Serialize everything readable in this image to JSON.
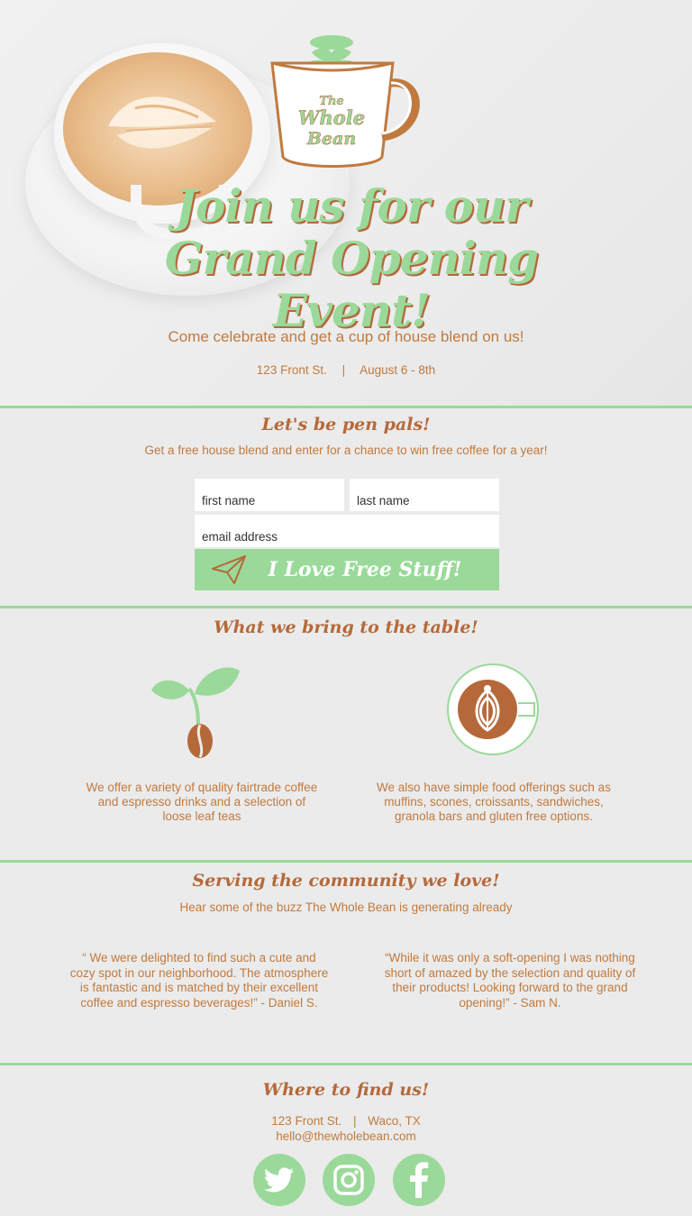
{
  "brand": {
    "logo_text": "The Whole Bean"
  },
  "hero": {
    "title_line1": "Join us for our",
    "title_line2": "Grand Opening Event!",
    "subtitle": "Come celebrate and get a cup of house blend on us!",
    "address": "123 Front St.",
    "separator": "|",
    "dates": "August 6 - 8th"
  },
  "signup": {
    "heading": "Let's be pen pals!",
    "description": "Get a free house blend and  enter for a chance to win free coffee for a year!",
    "first_name_placeholder": "first name",
    "last_name_placeholder": "last name",
    "email_placeholder": "email address",
    "button_label": "I Love Free Stuff!"
  },
  "features": {
    "heading": "What we bring to the table!",
    "items": [
      {
        "icon": "coffee-bean-sprout-icon",
        "text": "We offer a variety of quality fairtrade coffee and espresso drinks and a selection of loose leaf teas"
      },
      {
        "icon": "latte-cup-icon",
        "text": "We also have simple food offerings such as muffins, scones, croissants, sandwiches, granola bars and gluten free options."
      }
    ]
  },
  "testimonials": {
    "heading": "Serving the community we love!",
    "subheading": "Hear some of the buzz The Whole Bean is generating already",
    "quotes": [
      {
        "text": "“ We were delighted to find such a cute and cozy spot in our neighborhood. The atmosphere is fantastic and is matched by their excellent coffee and espresso beverages!”  - Daniel S."
      },
      {
        "text": "“While it was only a soft-opening I was nothing short of amazed by the selection and quality of their products! Looking forward to the grand opening!” - Sam N."
      }
    ]
  },
  "footer": {
    "heading": "Where to find us!",
    "address": "123 Front St.",
    "separator": "|",
    "city": "Waco, TX",
    "email": "hello@thewholebean.com",
    "social": [
      "twitter-icon",
      "instagram-icon",
      "facebook-icon"
    ]
  },
  "colors": {
    "accent_green": "#9ad99a",
    "brand_brown": "#b5693a",
    "text_brown": "#c07a3f",
    "background": "#ebebeb"
  }
}
